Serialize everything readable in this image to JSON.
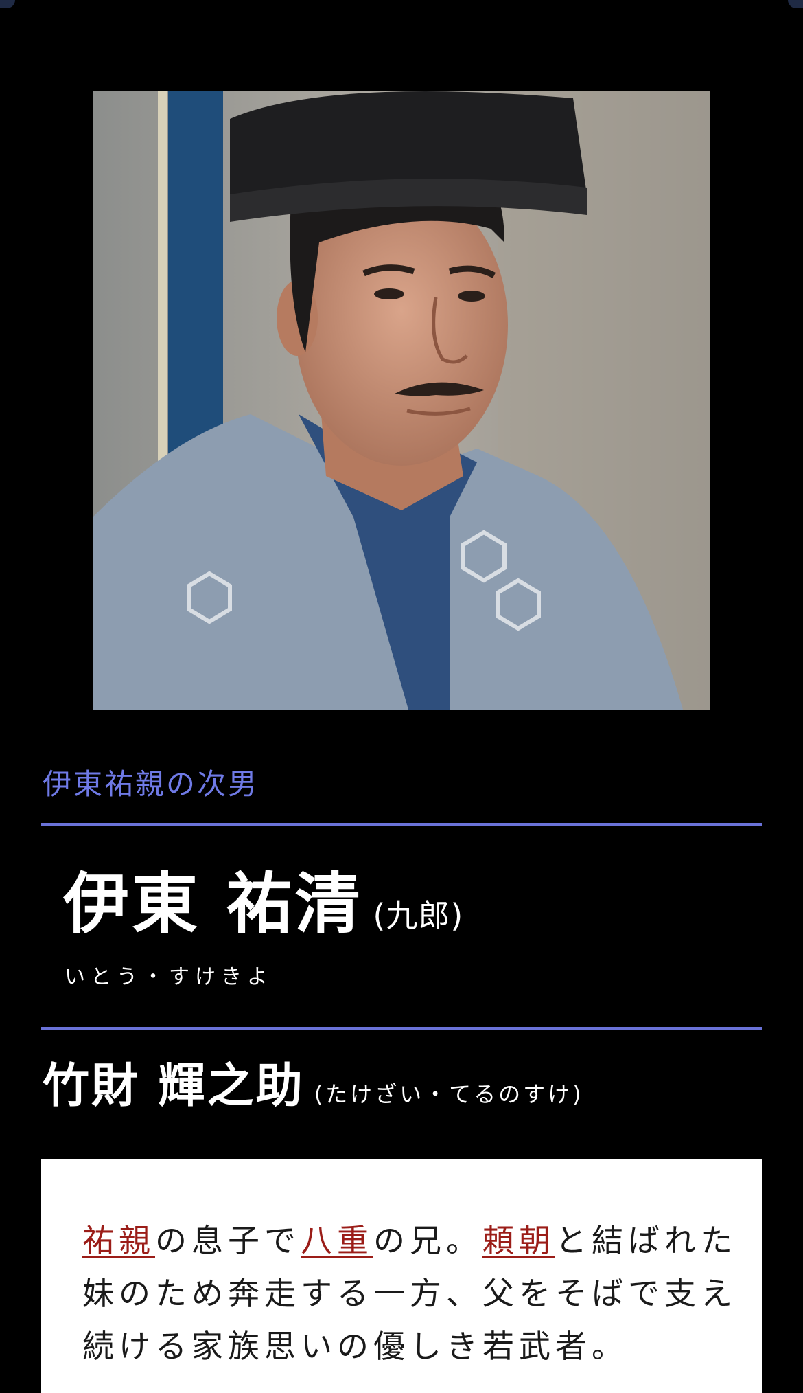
{
  "character": {
    "role": "伊東祐親の次男",
    "name": "伊東 祐清",
    "alias": "(九郎)",
    "reading": "いとう・すけきよ"
  },
  "actor": {
    "name": "竹財 輝之助",
    "reading": "(たけざい・てるのすけ)"
  },
  "description": {
    "link1": "祐親",
    "text1": "の息子で",
    "link2": "八重",
    "text2": "の兄。",
    "link3": "頼朝",
    "text3": "と結ばれた妹のため奔走する一方、父をそばで支え続ける家族思いの優しき若武者。"
  },
  "colors": {
    "background": "#000000",
    "accent": "#6a72d8",
    "link": "#9b1d18"
  }
}
